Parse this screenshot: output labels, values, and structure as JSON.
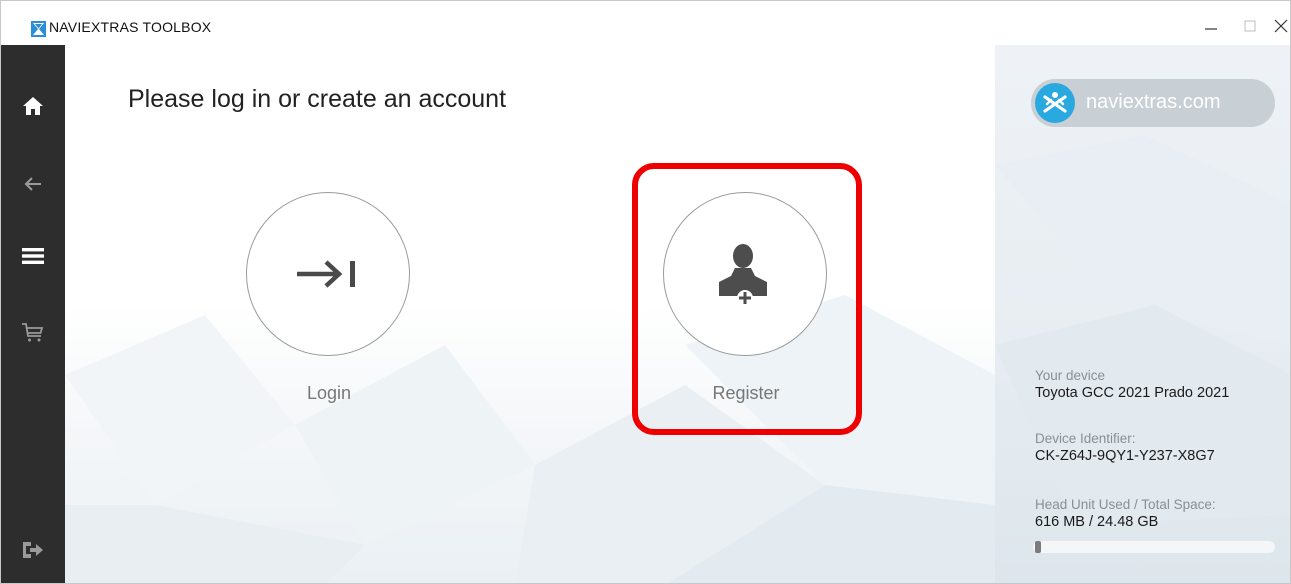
{
  "window": {
    "title": "NAVIEXTRAS TOOLBOX",
    "controls": {
      "minimize": "–",
      "maximize": "□",
      "close": "×"
    }
  },
  "sidebar": {
    "items": [
      {
        "icon": "home-icon"
      },
      {
        "icon": "back-arrow-icon"
      },
      {
        "icon": "menu-icon"
      },
      {
        "icon": "cart-icon"
      },
      {
        "icon": "logout-icon"
      }
    ]
  },
  "main": {
    "title": "Please log in or create an account",
    "login": {
      "label": "Login",
      "icon": "login-arrow-icon"
    },
    "register": {
      "label": "Register",
      "icon": "add-user-icon"
    },
    "highlight_color": "#ee0000"
  },
  "right_panel": {
    "brand_text": "naviextras.com",
    "device_label": "Your device",
    "device_value": "Toyota GCC 2021 Prado 2021",
    "identifier_label": "Device Identifier:",
    "identifier_value": "CK-Z64J-9QY1-Y237-X8G7",
    "space_label": "Head Unit Used / Total Space:",
    "space_value": "616 MB / 24.48 GB",
    "space_used_fraction": 0.025
  },
  "colors": {
    "sidebar": "#2d2d2d",
    "brand_blue": "#29a9e0",
    "accent_red": "#ee0000"
  }
}
